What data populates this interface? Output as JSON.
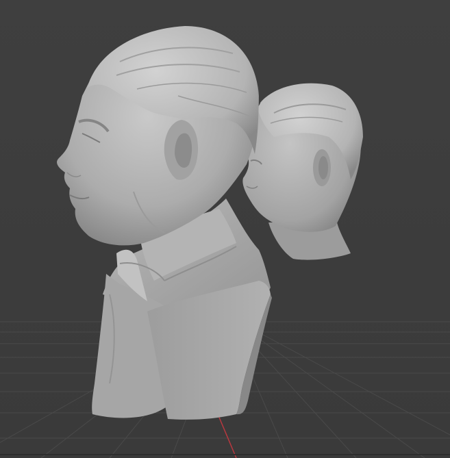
{
  "viewport": {
    "background_color": "#3d3d3d",
    "grid_line_color": "#4a4a4a",
    "x_axis_color": "#b8383f",
    "grid_visible": true
  },
  "objects": [
    {
      "name": "large-bust-with-collar",
      "material_color": "#a9a9a9"
    },
    {
      "name": "small-head-bust",
      "material_color": "#a9a9a9"
    }
  ]
}
